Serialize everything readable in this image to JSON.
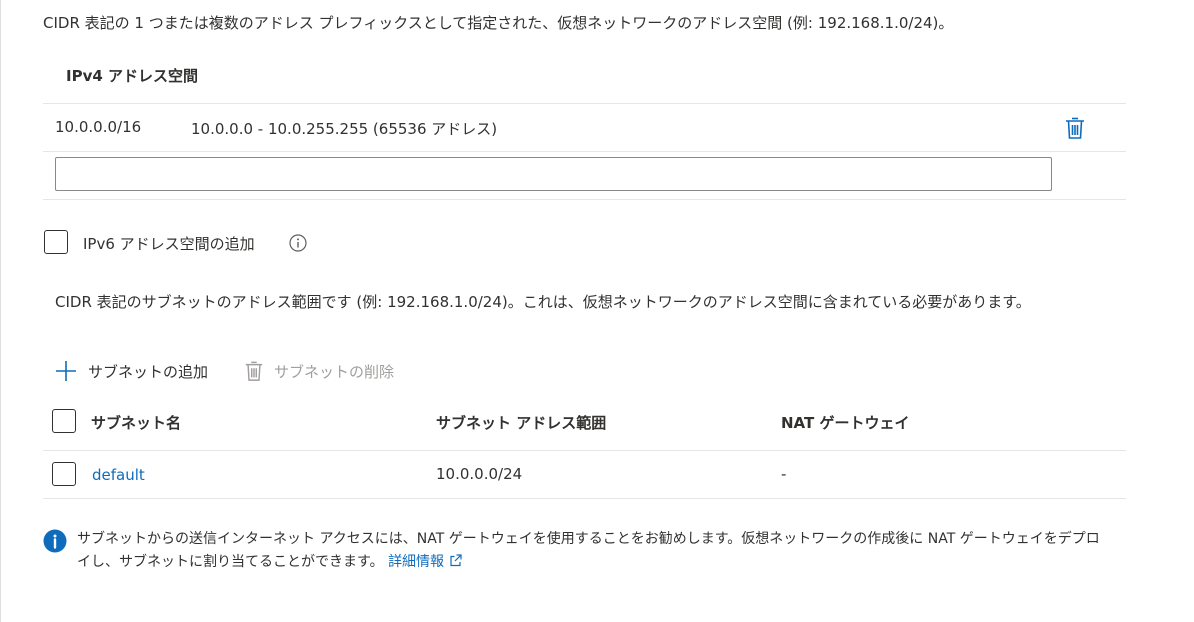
{
  "address_space": {
    "description": "CIDR 表記の 1 つまたは複数のアドレス プレフィックスとして指定された、仮想ネットワークのアドレス空間 (例: 192.168.1.0/24)。",
    "ipv4_header": "IPv4 アドレス空間",
    "rows": [
      {
        "cidr": "10.0.0.0/16",
        "range": "10.0.0.0 - 10.0.255.255 (65536 アドレス)"
      }
    ],
    "new_input_value": "",
    "ipv6_label": "IPv6 アドレス空間の追加"
  },
  "subnets": {
    "description": "CIDR 表記のサブネットのアドレス範囲です (例: 192.168.1.0/24)。これは、仮想ネットワークのアドレス空間に含まれている必要があります。",
    "add_label": "サブネットの追加",
    "delete_label": "サブネットの削除",
    "columns": {
      "name": "サブネット名",
      "range": "サブネット アドレス範囲",
      "nat": "NAT ゲートウェイ"
    },
    "rows": [
      {
        "name": "default",
        "range": "10.0.0.0/24",
        "nat": "-"
      }
    ]
  },
  "info_note": {
    "text": "サブネットからの送信インターネット アクセスには、NAT ゲートウェイを使用することをお勧めします。仮想ネットワークの作成後に NAT ゲートウェイをデプロイし、サブネットに割り当てることができます。",
    "link_label": "詳細情報"
  },
  "colors": {
    "accent": "#0f6cbd",
    "text": "#323130",
    "disabled": "#a19f9d",
    "border": "#e8e6e4"
  },
  "icons": [
    "trash-icon",
    "info-outline-icon",
    "plus-icon",
    "trash-disabled-icon",
    "info-filled-icon",
    "external-link-icon"
  ]
}
